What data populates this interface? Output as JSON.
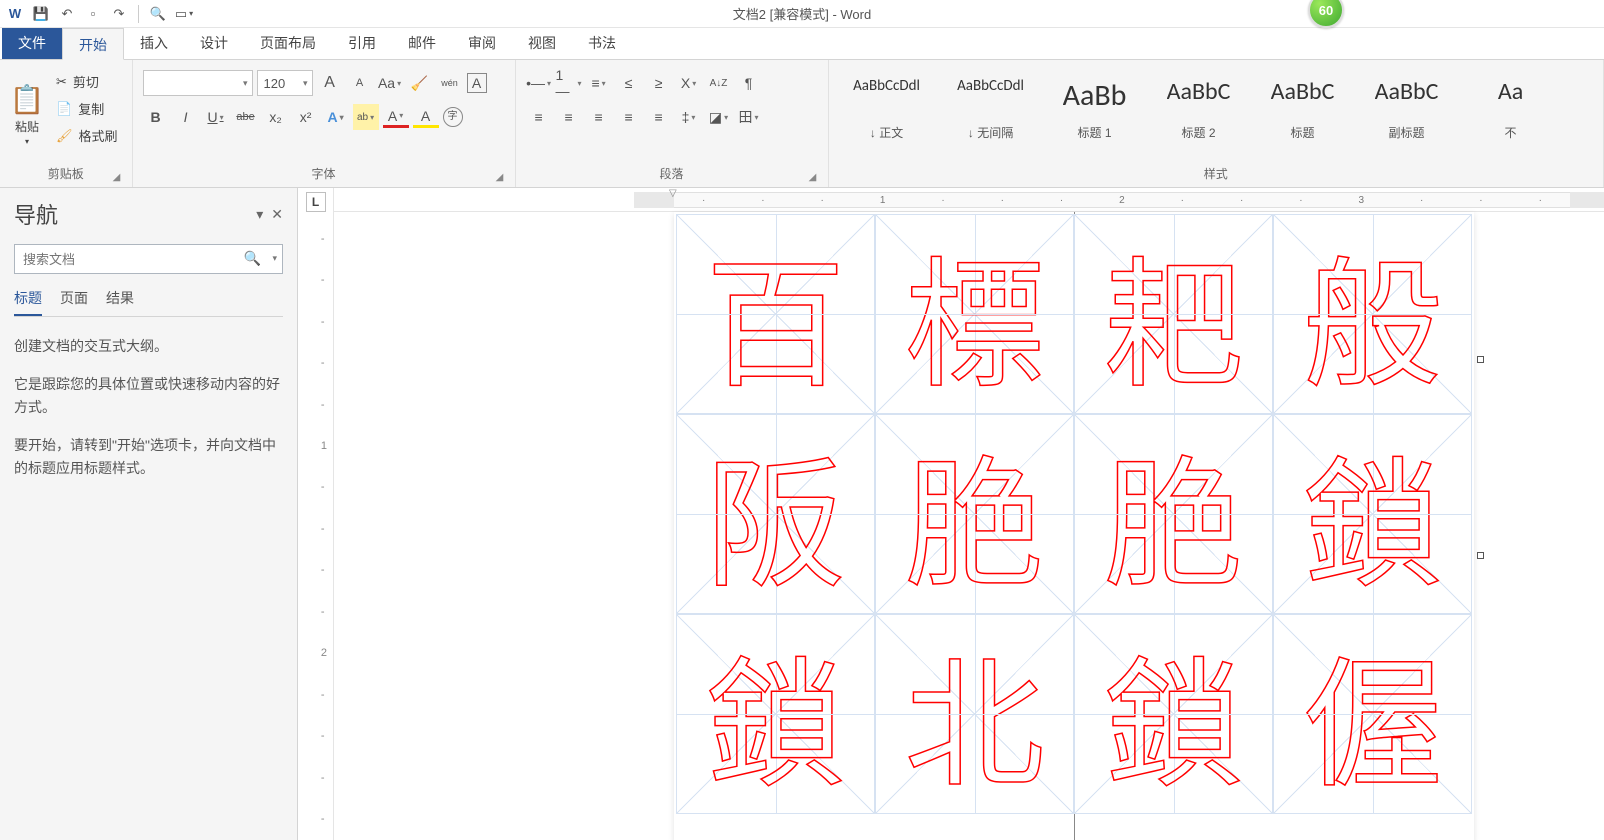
{
  "title": "文档2 [兼容模式] - Word",
  "badge": "60",
  "qat": {
    "undo": "↶",
    "redo": "↷",
    "save": "💾",
    "new": "▫",
    "open": "📄",
    "print": "🔍",
    "mode": "▭"
  },
  "tabs": {
    "file": "文件",
    "home": "开始",
    "insert": "插入",
    "design": "设计",
    "layout": "页面布局",
    "references": "引用",
    "mail": "邮件",
    "review": "审阅",
    "view": "视图",
    "calligraphy": "书法"
  },
  "clipboard": {
    "label": "剪贴板",
    "paste": "粘贴",
    "cut": "剪切",
    "copy": "复制",
    "format_painter": "格式刷"
  },
  "font": {
    "label": "字体",
    "name": "",
    "size": "120",
    "grow": "A",
    "shrink": "A",
    "case": "Aa",
    "clear": "◇",
    "phonetic": "wén",
    "charborder": "A",
    "bold": "B",
    "italic": "I",
    "underline": "U",
    "strike": "abe",
    "sub": "x₂",
    "sup": "x²",
    "effects": "A",
    "highlight": "ab",
    "color": "A",
    "enclose": "字"
  },
  "paragraph": {
    "label": "段落",
    "bullets": "•—",
    "numbering": "1—",
    "multilist": "≡",
    "dec_indent": "≤",
    "inc_indent": "≥",
    "asian_layout": "X",
    "sort": "A↓Z",
    "showmarks": "¶",
    "align_l": "≡",
    "align_c": "≡",
    "align_r": "≡",
    "align_j": "≡",
    "align_d": "≡",
    "line_spacing": "‡",
    "shading": "◪",
    "borders": "田"
  },
  "styles": {
    "label": "样式",
    "items": [
      {
        "sample": "AaBbCcDdl",
        "name": "↓ 正文",
        "size": 15
      },
      {
        "sample": "AaBbCcDdl",
        "name": "↓ 无间隔",
        "size": 15
      },
      {
        "sample": "AaBb",
        "name": "标题 1",
        "size": 30
      },
      {
        "sample": "AaBbC",
        "name": "标题 2",
        "size": 24
      },
      {
        "sample": "AaBbC",
        "name": "标题",
        "size": 24
      },
      {
        "sample": "AaBbC",
        "name": "副标题",
        "size": 24
      },
      {
        "sample": "Aa",
        "name": "不",
        "size": 24
      }
    ]
  },
  "nav": {
    "title": "导航",
    "search_placeholder": "搜索文档",
    "tabs": {
      "headings": "标题",
      "pages": "页面",
      "results": "结果"
    },
    "body": [
      "创建文档的交互式大纲。",
      "它是跟踪您的具体位置或快速移动内容的好方式。",
      "要开始，请转到\"开始\"选项卡，并向文档中的标题应用标题样式。"
    ]
  },
  "ruler": {
    "h_numbers": [
      "·",
      "·",
      "·",
      "1",
      "·",
      "·",
      "·",
      "2",
      "·",
      "·",
      "·",
      "3",
      "·",
      "·",
      "·"
    ]
  },
  "vruler": [
    "-",
    "-",
    "-",
    "-",
    "-",
    "1",
    "-",
    "-",
    "-",
    "-",
    "2",
    "-",
    "-",
    "-",
    "-"
  ],
  "document": {
    "characters": [
      "百",
      "標",
      "耙",
      "般",
      "阪",
      "脃",
      "脃",
      "鎖",
      "鎖",
      "北",
      "鎖",
      "偓"
    ]
  }
}
